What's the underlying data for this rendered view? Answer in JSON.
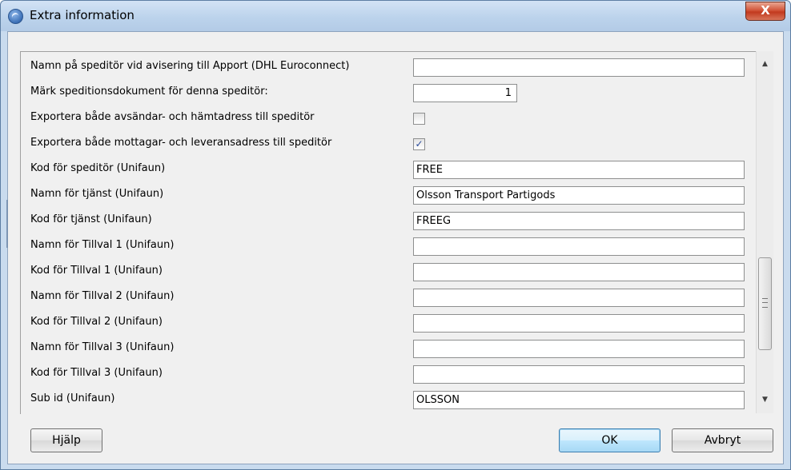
{
  "window": {
    "title": "Extra information",
    "close_glyph": "X",
    "icon": "app-globe-icon"
  },
  "rows": [
    {
      "label": "Namn på speditör vid avisering till Apport (DHL Euroconnect)",
      "type": "text",
      "value": ""
    },
    {
      "label": "Märk speditionsdokument för denna speditör:",
      "type": "number",
      "value": "1"
    },
    {
      "label": "Exportera både avsändar- och hämtadress till speditör",
      "type": "checkbox",
      "checked": false,
      "mark": ""
    },
    {
      "label": "Exportera både mottagar- och leveransadress till speditör",
      "type": "checkbox",
      "checked": true,
      "mark": "✓"
    },
    {
      "label": "Kod för speditör (Unifaun)",
      "type": "text",
      "value": "FREE"
    },
    {
      "label": "Namn för tjänst (Unifaun)",
      "type": "text",
      "value": "Olsson Transport Partigods"
    },
    {
      "label": "Kod för tjänst (Unifaun)",
      "type": "text",
      "value": "FREEG"
    },
    {
      "label": "Namn för Tillval 1 (Unifaun)",
      "type": "text",
      "value": ""
    },
    {
      "label": "Kod för Tillval 1 (Unifaun)",
      "type": "text",
      "value": ""
    },
    {
      "label": "Namn för Tillval 2 (Unifaun)",
      "type": "text",
      "value": ""
    },
    {
      "label": "Kod för Tillval 2 (Unifaun)",
      "type": "text",
      "value": ""
    },
    {
      "label": "Namn för Tillval 3 (Unifaun)",
      "type": "text",
      "value": ""
    },
    {
      "label": "Kod för Tillval 3 (Unifaun)",
      "type": "text",
      "value": ""
    },
    {
      "label": "Sub id (Unifaun)",
      "type": "text",
      "value": "OLSSON"
    }
  ],
  "scrollbar": {
    "up_glyph": "▲",
    "down_glyph": "▼"
  },
  "buttons": {
    "help": "Hjälp",
    "ok": "OK",
    "cancel": "Avbryt"
  }
}
